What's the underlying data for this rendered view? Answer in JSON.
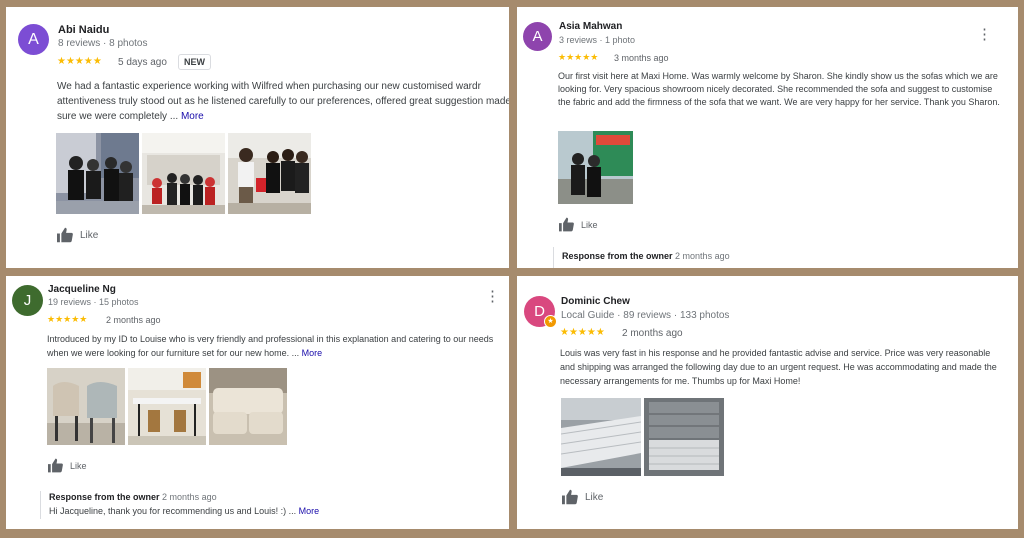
{
  "colors": {
    "frame": "#a68b6d",
    "star": "#fbbc04",
    "link": "#1a0dab",
    "avatar_abi": "#7c4dd4",
    "avatar_asia": "#8e44ad",
    "avatar_jacqueline": "#3e6b2e",
    "avatar_dominic": "#d9487f"
  },
  "reviews": [
    {
      "avatar_letter": "A",
      "name": "Abi Naidu",
      "meta": "8 reviews · 8 photos",
      "stars": "★★★★★",
      "rating": 5,
      "time": "5 days ago",
      "badge": "NEW",
      "text": "We had a fantastic experience working with Wilfred when purchasing our new customised wardr attentiveness truly stood out as he listened carefully to our preferences, offered great suggestion made sure we were completely ...",
      "more": "More",
      "like": "Like"
    },
    {
      "avatar_letter": "A",
      "name": "Asia Mahwan",
      "meta": "3 reviews · 1 photo",
      "stars": "★★★★★",
      "rating": 5,
      "time": "3 months ago",
      "text": "Our first visit here at Maxi Home. Was warmly welcome by Sharon. She kindly show us the sofas which we are looking for.  Very spacious showroom nicely decorated. She recommended the sofa and suggest to customise the fabric and add the firmness of the sofa that we want. We are very happy for her service. Thank you Sharon.",
      "like": "Like",
      "owner_title": "Response from the owner",
      "owner_time": "2 months ago"
    },
    {
      "avatar_letter": "J",
      "name": "Jacqueline Ng",
      "meta": "19 reviews · 15 photos",
      "stars": "★★★★★",
      "rating": 5,
      "time": "2 months ago",
      "text": "Introduced by my ID to Louise who is very friendly and professional in this explanation and catering to our needs when we were looking for our furniture set for our new home. ...",
      "more": "More",
      "like": "Like",
      "owner_title": "Response from the owner",
      "owner_time": "2 months ago",
      "owner_text": "Hi Jacqueline, thank you for recommending us and Louis! :) ...",
      "owner_more": "More"
    },
    {
      "avatar_letter": "D",
      "name": "Dominic Chew",
      "meta": "Local Guide · 89 reviews · 133 photos",
      "stars": "★★★★★",
      "rating": 5,
      "time": "2 months ago",
      "text": "Louis was very fast in his response and he provided fantastic advise and service. Price was very reasonable and shipping was arranged the following day due to an urgent request. He was accommodating and made the necessary arrangements for me. Thumbs up for Maxi Home!",
      "like": "Like"
    }
  ]
}
